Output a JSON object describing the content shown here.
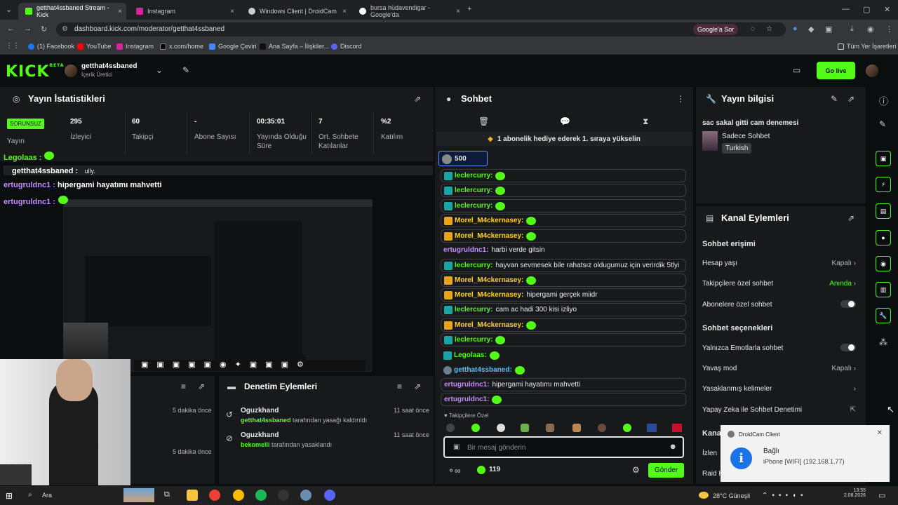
{
  "browser": {
    "tabs": [
      {
        "title": "getthat4ssbaned Stream - Kick",
        "active": true
      },
      {
        "title": "Instagram",
        "active": false
      },
      {
        "title": "Windows Client | DroidCam",
        "active": false
      },
      {
        "title": "bursa hüdavendigar - Google'da",
        "active": false
      }
    ],
    "url": "dashboard.kick.com/moderator/getthat4ssbaned",
    "search_chip": "Google'a Sor",
    "bookmarks": [
      "(1) Facebook",
      "YouTube",
      "Instagram",
      "x.com/home",
      "Google Çeviri",
      "Ana Sayfa – İlişkiler...",
      "Discord"
    ],
    "all_bookmarks": "Tüm Yer İşaretleri"
  },
  "header": {
    "logo": "KICK",
    "logo_tag": "BETA",
    "channel_name": "getthat4ssbaned",
    "channel_role": "İçerik Üretici",
    "go_live": "Go live"
  },
  "stats": {
    "title": "Yayın İstatistikleri",
    "status_badge": "SORUNSUZ",
    "status_label": "Yayın",
    "items": [
      {
        "value": "295",
        "label": "İzleyici"
      },
      {
        "value": "60",
        "label": "Takipçi"
      },
      {
        "value": "-",
        "label": "Abone Sayısı"
      },
      {
        "value": "00:35:01",
        "label": "Yayında Olduğu Süre"
      },
      {
        "value": "7",
        "label": "Ort. Sohbete Katılanlar"
      },
      {
        "value": "%2",
        "label": "Katılım"
      }
    ]
  },
  "overlay_chat": {
    "lines": [
      {
        "user": "Legolaas :",
        "text": ""
      },
      {
        "user": "getthat4ssbaned :",
        "text": "ully."
      },
      {
        "user": "ertugruldnc1 :",
        "text": "hipergami hayatımı mahvetti"
      },
      {
        "user": "ertugruldnc1 :",
        "text": ""
      }
    ]
  },
  "activity": {
    "title": "Denetim Eylemleri",
    "left_times": [
      "5 dakika önce",
      "5 dakika önce"
    ],
    "items": [
      {
        "user": "Oguzkhand",
        "target": "getthat4ssbaned",
        "action": "tarafından yasağı kaldırıldı",
        "time": "11 saat önce"
      },
      {
        "user": "Oguzkhand",
        "target": "bekomelli",
        "action": "tarafından yasaklandı",
        "time": "11 saat önce"
      }
    ]
  },
  "chat": {
    "title": "Sohbet",
    "pinned": "1 abonelik hediye ederek 1. sıraya yükselin",
    "goal_value": "500",
    "messages": [
      {
        "user": "leclercurry:",
        "text": "",
        "color": "green"
      },
      {
        "user": "leclercurry:",
        "text": "",
        "color": "green"
      },
      {
        "user": "leclercurry:",
        "text": "",
        "color": "green"
      },
      {
        "user": "Morel_M4ckernasey:",
        "text": "",
        "color": "yellow"
      },
      {
        "user": "Morel_M4ckernasey:",
        "text": "",
        "color": "yellow"
      },
      {
        "user": "ertugruldnc1:",
        "text": "harbi verde gitsin",
        "color": "purple"
      },
      {
        "user": "leclercurry:",
        "text": "hayvan sevmesek bile rahatsız oldugumuz için verirdik 5tlyi",
        "color": "green"
      },
      {
        "user": "Morel_M4ckernasey:",
        "text": "",
        "color": "yellow"
      },
      {
        "user": "Morel_M4ckernasey:",
        "text": "hipergami gerçek miidr",
        "color": "yellow"
      },
      {
        "user": "leclercurry:",
        "text": "cam ac hadi 300 kisi izliyo",
        "color": "green"
      },
      {
        "user": "Morel_M4ckernasey:",
        "text": "",
        "color": "yellow"
      },
      {
        "user": "leclercurry:",
        "text": "",
        "color": "green"
      },
      {
        "user": "Legolaas:",
        "text": "",
        "color": "green"
      },
      {
        "user": "getthat4ssbaned:",
        "text": "",
        "color": "cyan"
      },
      {
        "user": "ertugruldnc1:",
        "text": "hipergami hayatımı mahvetti",
        "color": "purple"
      },
      {
        "user": "ertugruldnc1:",
        "text": "",
        "color": "purple"
      }
    ],
    "emote_section": "Takipçilere Özel",
    "input_placeholder": "Bir mesaj gönderin",
    "points": "119",
    "send": "Gönder"
  },
  "stream_info": {
    "title": "Yayın bilgisi",
    "stream_title": "sac sakal gitti cam denemesi",
    "category": "Sadece Sohbet",
    "tag": "Turkish"
  },
  "channel_actions": {
    "title": "Kanal Eylemleri",
    "section1": "Sohbet erişimi",
    "rows1": [
      {
        "label": "Hesap yaşı",
        "value": "Kapalı"
      },
      {
        "label": "Takipçilere özel sohbet",
        "value": "Anında"
      },
      {
        "label": "Abonelere özel sohbet",
        "value": ""
      }
    ],
    "section2": "Sohbet seçenekleri",
    "rows2": [
      {
        "label": "Yalnızca Emotlarla sohbet",
        "value": ""
      },
      {
        "label": "Yavaş mod",
        "value": "Kapalı"
      },
      {
        "label": "Yasaklanmış kelimeler",
        "value": ""
      },
      {
        "label": "Yapay Zeka ile Sohbet Denetimi",
        "value": ""
      }
    ],
    "partial1": "Kana",
    "partial2": "İzlen",
    "partial3": "Raid K"
  },
  "toast": {
    "app": "DroidCam Client",
    "title": "Bağlı",
    "body": "iPhone [WIFI] (192.168.1.77)"
  },
  "taskbar": {
    "weather": "28°C  Güneşli",
    "time": "13:55",
    "date": "2.08.2026",
    "search": "Ara"
  },
  "colors": {
    "accent": "#53fc18"
  }
}
